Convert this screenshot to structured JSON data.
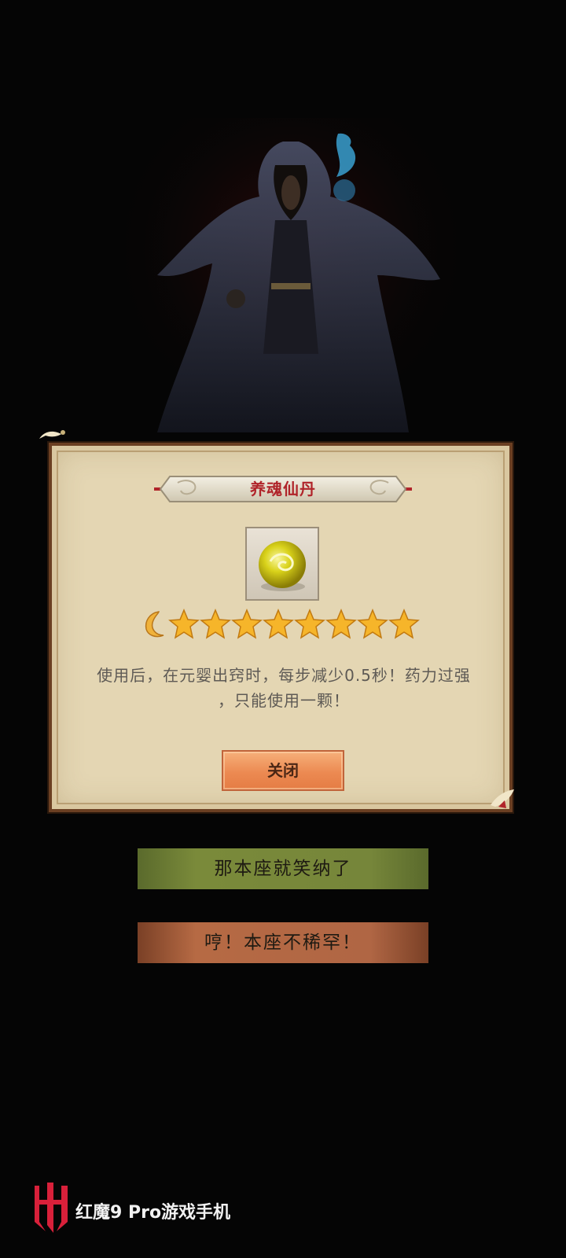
{
  "item": {
    "name": "养魂仙丹",
    "description_line1": "使用后，在元婴出窍时，每步减少0.5秒！药力过强",
    "description_line2": "，只能使用一颗！",
    "rating": {
      "moons": 1,
      "stars": 8
    }
  },
  "dialog": {
    "close_label": "关闭"
  },
  "choices": {
    "accept_label": "那本座就笑纳了",
    "refuse_label": "哼！本座不稀罕！"
  },
  "watermark": {
    "brand_text": "红魔9 Pro游戏手机"
  },
  "colors": {
    "title_red": "#b0242a",
    "accept_green": "#76863a",
    "refuse_orange": "#b06644",
    "close_orange": "#ec8a52"
  },
  "icons": [
    "moon-icon",
    "star-icon",
    "pill-orb-icon",
    "brand-logo-icon"
  ]
}
